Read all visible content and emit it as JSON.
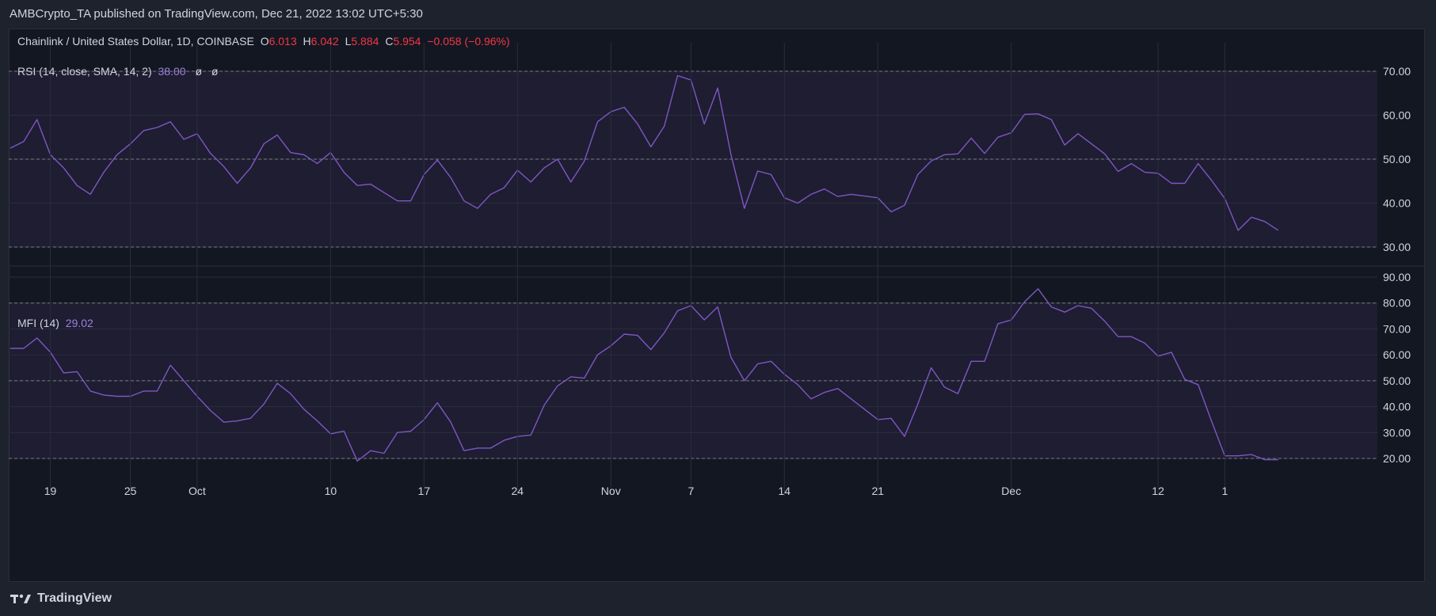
{
  "header": {
    "published_text": "AMBCrypto_TA published on TradingView.com, Dec 21, 2022 13:02 UTC+5:30"
  },
  "symbol_legend": {
    "name": "Chainlink / United States Dollar, 1D, COINBASE",
    "open_label": "O",
    "open": "6.013",
    "high_label": "H",
    "high": "6.042",
    "low_label": "L",
    "low": "5.884",
    "close_label": "C",
    "close": "5.954",
    "change": "−0.058 (−0.96%)"
  },
  "rsi_legend": {
    "name": "RSI (14, close, SMA, 14, 2)",
    "value": "38.00",
    "sym1": "ø",
    "sym2": "ø"
  },
  "mfi_legend": {
    "name": "MFI (14)",
    "value": "29.02"
  },
  "footer": {
    "brand": "TradingView"
  },
  "colors": {
    "line": "#7e57c2",
    "band_fill": "#7e57c2",
    "background": "#131722",
    "price_red": "#f23645"
  },
  "chart_data": [
    {
      "type": "line",
      "indicator": "RSI",
      "ylim": [
        30,
        70
      ],
      "y_ticks": [
        "30.00",
        "40.00",
        "50.00",
        "60.00",
        "70.00"
      ],
      "levels": [
        30,
        50,
        70
      ],
      "x_tick_labels": [
        "19",
        "25",
        "Oct",
        "10",
        "17",
        "24",
        "Nov",
        "7",
        "14",
        "21",
        "Dec",
        "12",
        "1"
      ],
      "x_tick_days": [
        3,
        9,
        14,
        24,
        31,
        38,
        45,
        51,
        58,
        65,
        75,
        86,
        91
      ],
      "values": [
        52.5,
        54,
        59,
        51,
        48,
        44,
        42,
        47,
        51,
        53.5,
        56.5,
        57.2,
        58.5,
        54.5,
        55.8,
        51.3,
        48.3,
        44.5,
        48,
        53.5,
        55.5,
        51.5,
        51,
        49,
        51.5,
        47,
        44,
        44.3,
        42.4,
        40.5,
        40.5,
        46.5,
        49.8,
        45.8,
        40.5,
        38.8,
        42,
        43.5,
        47.5,
        44.8,
        48,
        50,
        44.8,
        49.5,
        58.5,
        60.8,
        61.8,
        58,
        52.8,
        57.5,
        69,
        68,
        58,
        66.2,
        51,
        38.8,
        47.3,
        46.5,
        41.2,
        40,
        42,
        43.2,
        41.5,
        42,
        41.6,
        41.2,
        38,
        39.5,
        46.5,
        49.6,
        51,
        51.2,
        54.8,
        51.3,
        55,
        56,
        60.2,
        60.3,
        59,
        53.2,
        55.8,
        53.5,
        51.2,
        47.2,
        49,
        47,
        46.8,
        44.5,
        44.5,
        49,
        45.2,
        41,
        33.8,
        36.8,
        35.8,
        33.8
      ]
    },
    {
      "type": "line",
      "indicator": "MFI",
      "ylim": [
        20,
        90
      ],
      "y_ticks": [
        "20.00",
        "30.00",
        "40.00",
        "50.00",
        "60.00",
        "70.00",
        "80.00",
        "90.00"
      ],
      "levels": [
        20,
        50,
        80
      ],
      "x_tick_labels": [
        "19",
        "25",
        "Oct",
        "10",
        "17",
        "24",
        "Nov",
        "7",
        "14",
        "21",
        "Dec",
        "12",
        "1"
      ],
      "x_tick_days": [
        3,
        9,
        14,
        24,
        31,
        38,
        45,
        51,
        58,
        65,
        75,
        86,
        91
      ],
      "values": [
        62.5,
        62.5,
        66.5,
        61,
        53,
        53.5,
        46,
        44.5,
        44,
        44,
        46,
        46,
        56,
        50,
        44,
        38.5,
        34,
        34.5,
        35.5,
        41,
        49,
        45,
        39,
        34.5,
        29.5,
        30.5,
        19,
        23,
        22,
        30,
        30.5,
        35,
        41.5,
        34,
        23,
        24,
        24,
        27,
        28.5,
        29,
        40.5,
        48,
        51.5,
        51,
        60,
        63.5,
        68,
        67.5,
        62,
        68.5,
        77,
        79,
        73.5,
        78.5,
        59,
        50,
        56.5,
        57.5,
        52.5,
        48.5,
        43,
        45.5,
        47,
        43,
        39,
        35,
        35.5,
        28.5,
        41,
        55,
        47.5,
        45,
        57.5,
        57.5,
        72,
        73.5,
        80.5,
        85.5,
        78.5,
        76.5,
        79,
        78,
        73,
        67,
        67,
        64.5,
        59.5,
        61,
        50.5,
        48.5,
        34.5,
        21,
        21,
        21.5,
        19.5,
        19.5
      ]
    }
  ]
}
